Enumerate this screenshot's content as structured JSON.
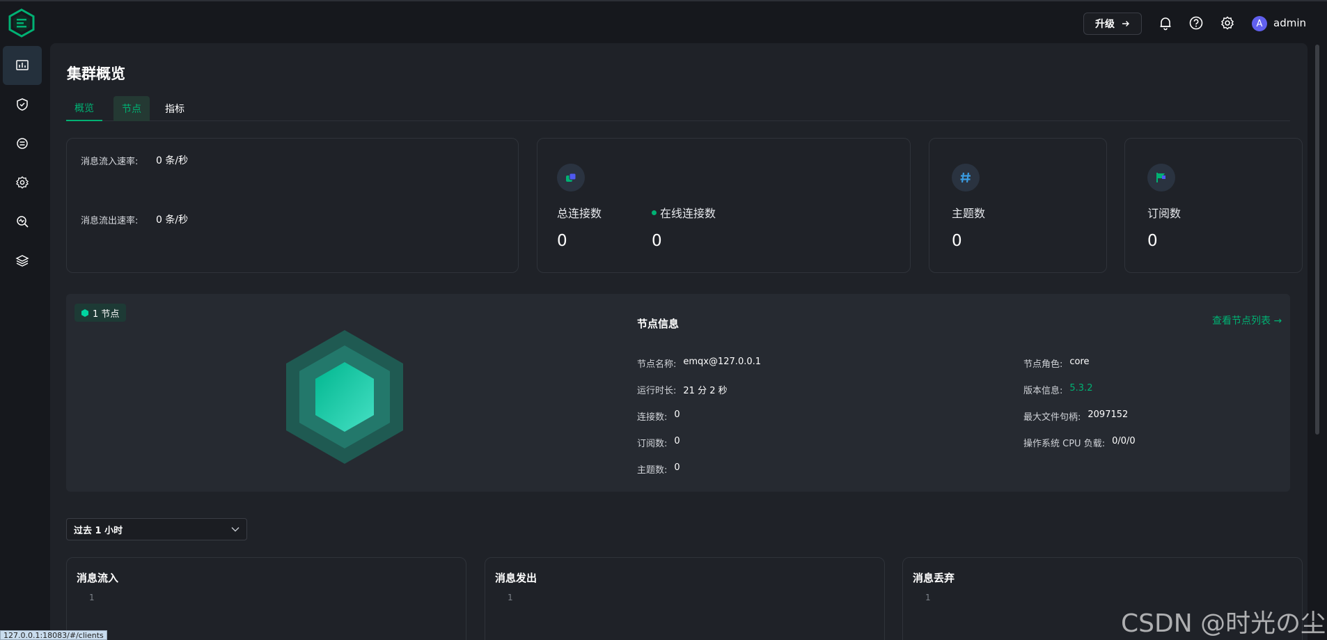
{
  "header": {
    "upgrade_label": "升级",
    "username": "admin",
    "avatar_letter": "A"
  },
  "sidebar": {
    "items": [
      {
        "icon": "dashboard-chart-icon",
        "active": true
      },
      {
        "icon": "shield-check-icon",
        "active": false
      },
      {
        "icon": "integration-icon",
        "active": false
      },
      {
        "icon": "settings-gear-icon",
        "active": false
      },
      {
        "icon": "diagnose-search-icon",
        "active": false
      },
      {
        "icon": "layers-icon",
        "active": false
      }
    ]
  },
  "page": {
    "title": "集群概览",
    "tabs": [
      "概览",
      "节点",
      "指标"
    ]
  },
  "rates": {
    "in_label": "消息流入速率:",
    "in_value": "0 条/秒",
    "out_label": "消息流出速率:",
    "out_value": "0 条/秒"
  },
  "stats": {
    "total_connections_label": "总连接数",
    "total_connections": "0",
    "online_connections_label": "在线连接数",
    "online_connections": "0",
    "topics_label": "主题数",
    "topics": "0",
    "subscriptions_label": "订阅数",
    "subscriptions": "0"
  },
  "node": {
    "badge": "1 节点",
    "info_title": "节点信息",
    "view_list_link": "查看节点列表 →",
    "left_rows": [
      {
        "k": "节点名称:",
        "v": "emqx@127.0.0.1"
      },
      {
        "k": "运行时长:",
        "v": "21 分 2 秒"
      },
      {
        "k": "连接数:",
        "v": "0"
      },
      {
        "k": "订阅数:",
        "v": "0"
      },
      {
        "k": "主题数:",
        "v": "0"
      }
    ],
    "right_rows": [
      {
        "k": "节点角色:",
        "v": "core"
      },
      {
        "k": "版本信息:",
        "v": "5.3.2"
      },
      {
        "k": "最大文件句柄:",
        "v": "2097152"
      },
      {
        "k": "操作系统 CPU 负载:",
        "v": "0/0/0"
      }
    ]
  },
  "time_range": {
    "selected": "过去 1 小时"
  },
  "charts": [
    {
      "title": "消息流入",
      "tick": "1"
    },
    {
      "title": "消息发出",
      "tick": "1"
    },
    {
      "title": "消息丢弃",
      "tick": "1"
    }
  ],
  "watermark": "CSDN @时光の尘",
  "status_url": "127.0.0.1:18083/#/clients",
  "colors": {
    "accent": "#00b173",
    "background": "#16181d",
    "panel": "#1f2228"
  }
}
